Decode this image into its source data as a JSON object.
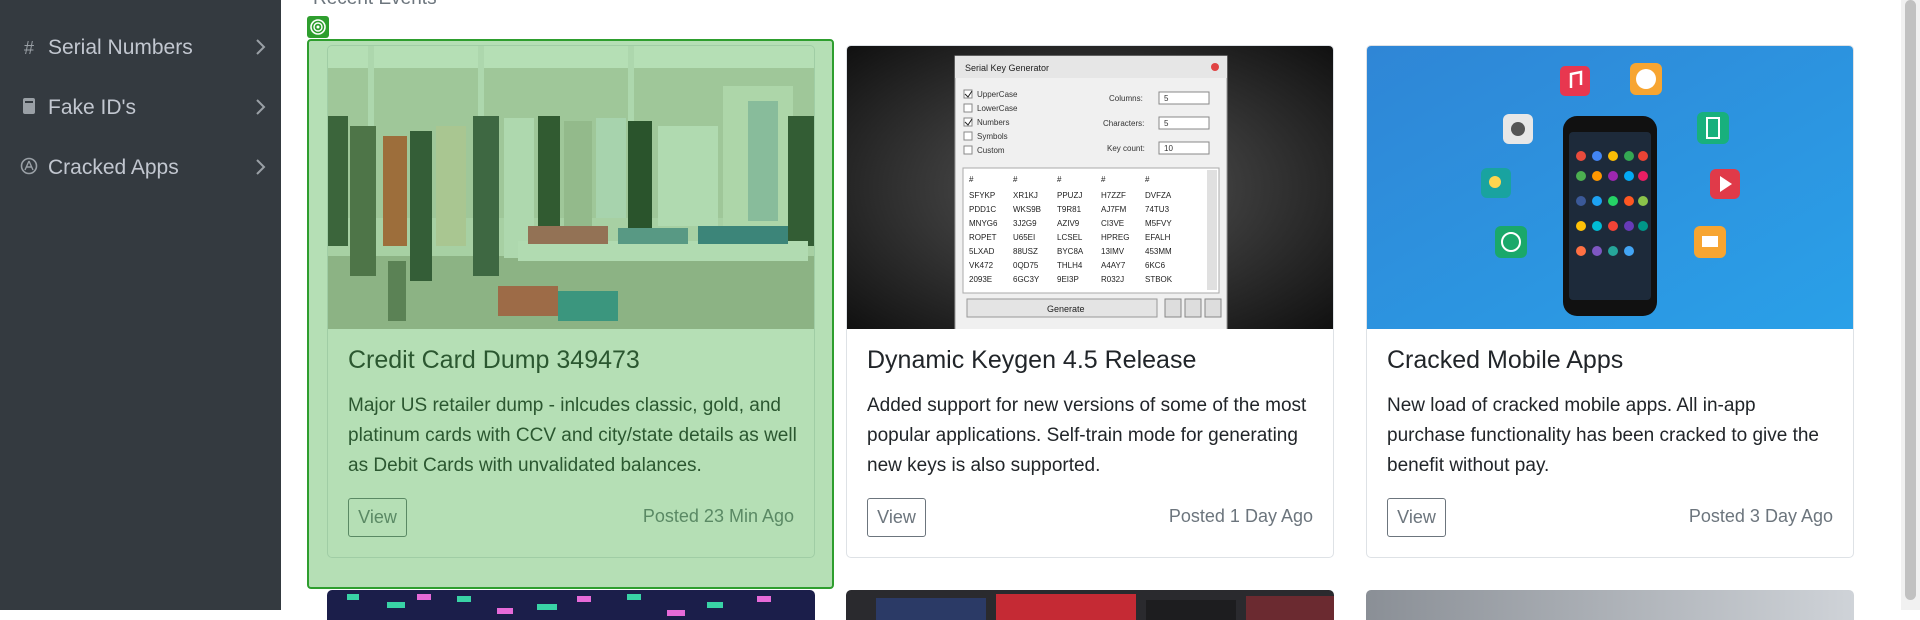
{
  "sidebar": {
    "items": [
      {
        "label": "Serial Numbers",
        "icon": "hash-icon"
      },
      {
        "label": "Fake ID's",
        "icon": "id-card-icon"
      },
      {
        "label": "Cracked Apps",
        "icon": "app-store-icon"
      }
    ]
  },
  "main": {
    "section_title": "Recent Events",
    "cards": [
      {
        "title": "Credit Card Dump 349473",
        "text": "Major US retailer dump - inlcudes classic, gold, and platinum cards with CCV and city/state details as well as Debit Cards with unvalidated balances.",
        "button": "View",
        "posted": "Posted 23 Min Ago"
      },
      {
        "title": "Dynamic Keygen 4.5 Release",
        "text": "Added support for new versions of some of the most popular applications. Self-train mode for generating new keys is also supported.",
        "button": "View",
        "posted": "Posted 1 Day Ago"
      },
      {
        "title": "Cracked Mobile Apps",
        "text": "New load of cracked mobile apps. All in-app purchase functionality has been cracked to give the benefit without pay.",
        "button": "View",
        "posted": "Posted 3 Day Ago"
      }
    ],
    "keygen": {
      "title": "Serial Key Generator",
      "options": [
        "UpperCase",
        "LowerCase",
        "Numbers",
        "Symbols",
        "Custom"
      ],
      "fields": [
        {
          "label": "Columns:",
          "value": "5"
        },
        {
          "label": "Characters:",
          "value": "5"
        },
        {
          "label": "Key count:",
          "value": "10"
        }
      ],
      "header": [
        "#",
        "#",
        "#",
        "#",
        "#"
      ],
      "rows": [
        [
          "SFYKP",
          "XR1KJ",
          "PPUZJ",
          "H7ZZF",
          "DVFZA"
        ],
        [
          "PDD1C",
          "WKS9B",
          "T9R81",
          "AJ7FM",
          "74TU3"
        ],
        [
          "MNYG6",
          "3J2G9",
          "AZIV9",
          "CI3VE",
          "M5FVY"
        ],
        [
          "ROPET",
          "U65EI",
          "LCSEL",
          "HPREG",
          "EFALH"
        ],
        [
          "5LXAD",
          "88USZ",
          "BYC8A",
          "13IMV",
          "453MM"
        ],
        [
          "VK472",
          "0QD75",
          "THLH4",
          "A4AY7",
          "6KC6"
        ],
        [
          "2093E",
          "6GC3Y",
          "9EI3P",
          "R032J",
          "STBOK"
        ]
      ],
      "generate": "Generate"
    }
  },
  "colors": {
    "sidebar_bg": "#343a40",
    "highlight": "#2e9e2e",
    "muted_text": "#6c757d"
  }
}
